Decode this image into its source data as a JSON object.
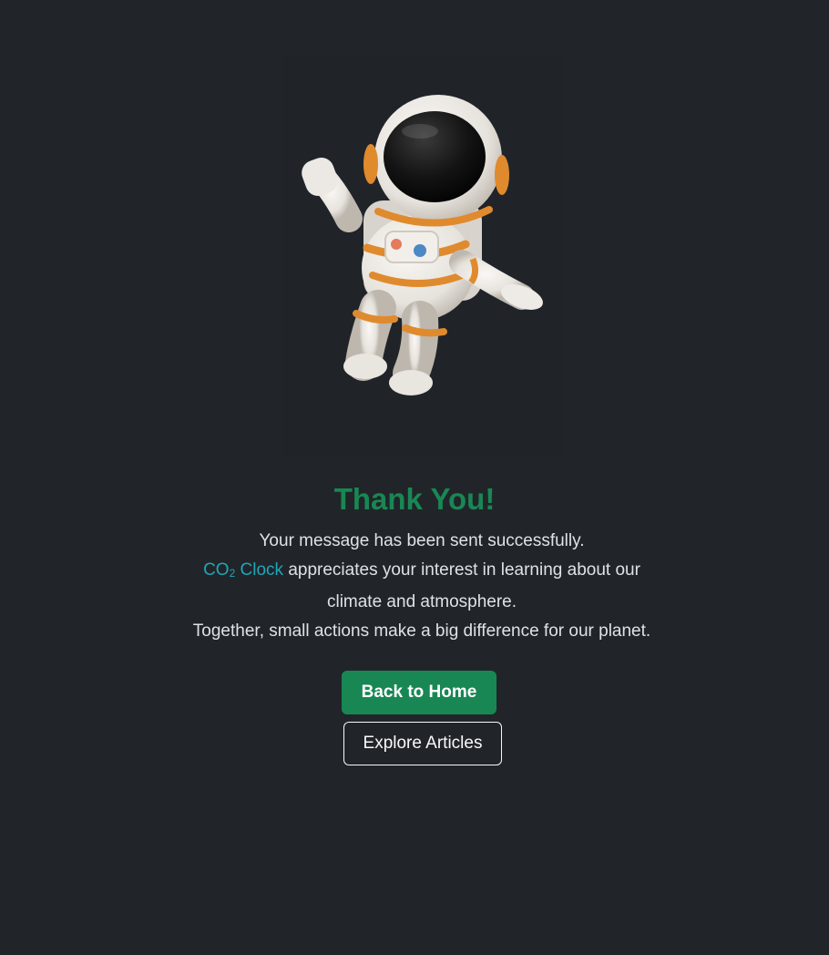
{
  "hero": {
    "image_alt": "astronaut-waving-illustration"
  },
  "content": {
    "title": "Thank You!",
    "line1": "Your message has been sent successfully.",
    "brand_prefix": "CO",
    "brand_sub": "2",
    "brand_suffix": " Clock",
    "line2_rest": " appreciates your interest in learning about our climate and atmosphere.",
    "line3": "Together, small actions make a big difference for our planet."
  },
  "actions": {
    "home_label": "Back to Home",
    "articles_label": "Explore Articles"
  },
  "colors": {
    "background": "#212529",
    "accent": "#198754",
    "brand": "#1fa7b8",
    "text": "#dee2e6"
  }
}
